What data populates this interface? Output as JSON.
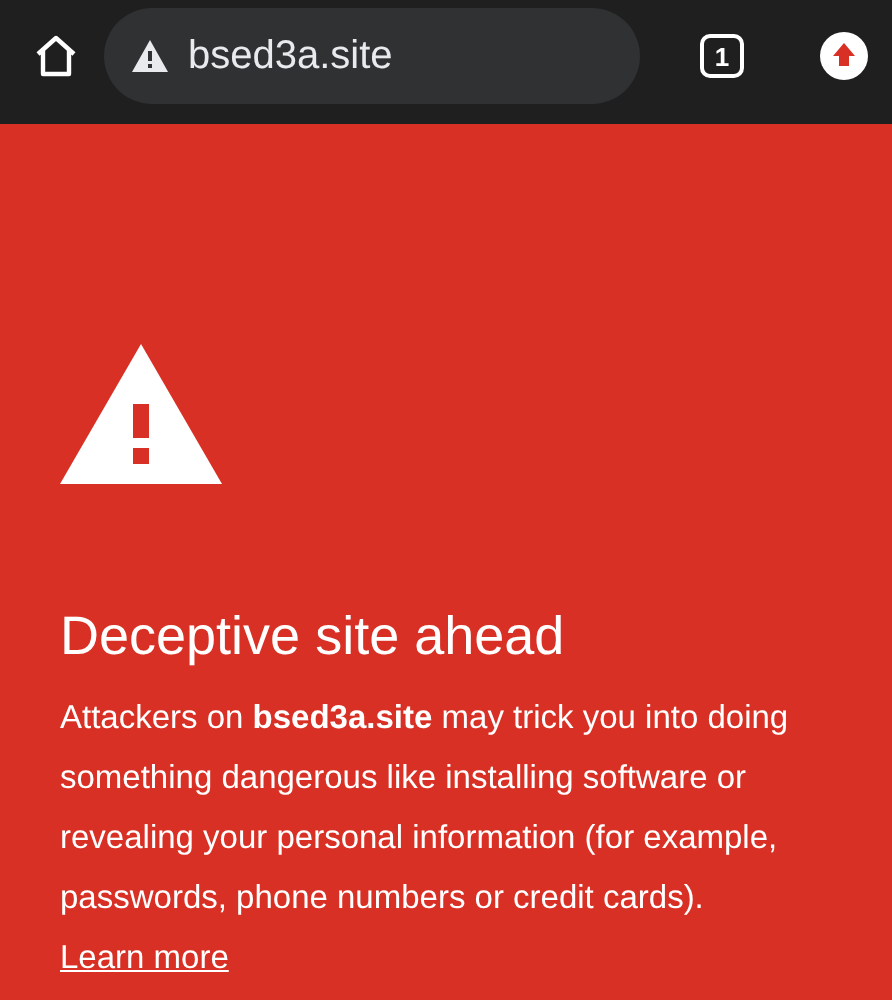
{
  "toolbar": {
    "url": "bsed3a.site",
    "tab_count": "1"
  },
  "warning": {
    "title": "Deceptive site ahead",
    "message": "Attackers on **bsed3a.site** may trick you into doing something dangerous like installing software or revealing your personal information (for example, passwords, phone numbers or credit cards).",
    "link": "Learn more"
  }
}
